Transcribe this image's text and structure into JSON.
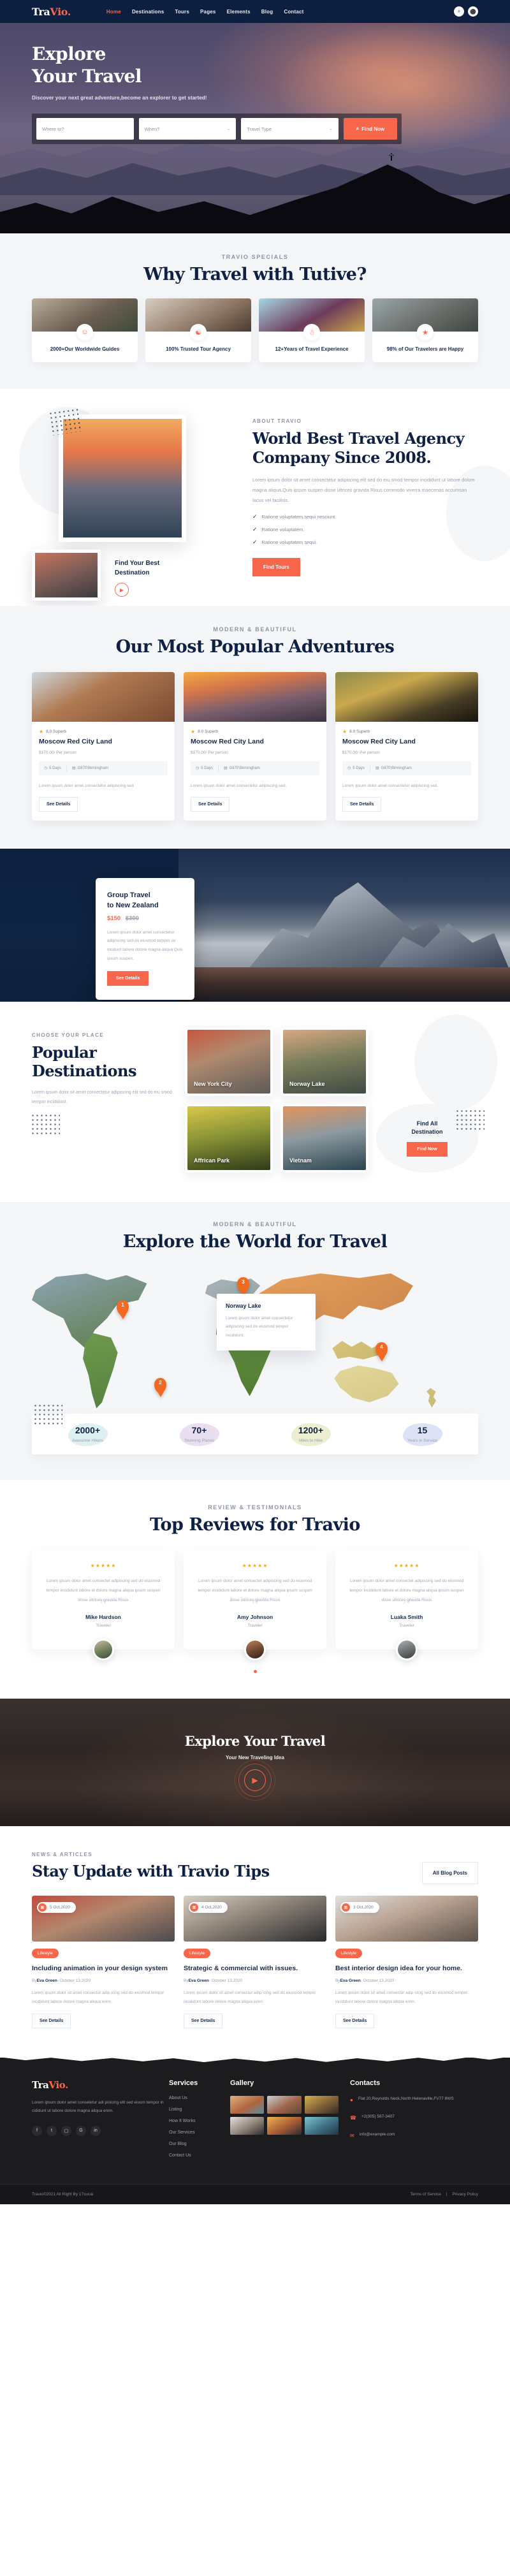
{
  "header": {
    "logo_main": "Tra",
    "logo_accent": "Vio",
    "logo_dot": ".",
    "nav": [
      {
        "label": "Home",
        "active": true
      },
      {
        "label": "Destinations",
        "active": false
      },
      {
        "label": "Tours",
        "active": false
      },
      {
        "label": "Pages",
        "active": false
      },
      {
        "label": "Elements",
        "active": false
      },
      {
        "label": "Blog",
        "active": false
      },
      {
        "label": "Contact",
        "active": false
      }
    ],
    "search_icon": "search-icon",
    "account_icon": "user-icon"
  },
  "hero": {
    "title_line1": "Explore",
    "title_line2": "Your Travel",
    "subtitle": "Discover your next great adventure,become an explorer to get started!",
    "search": {
      "where_placeholder": "Where to?",
      "when_placeholder": "When?",
      "type_placeholder": "Travel Type",
      "button_label": "Find Now"
    }
  },
  "specials": {
    "eyebrow": "TRAVIO SPECIALS",
    "title": "Why Travel with Tutive?",
    "cards": [
      {
        "icon": "guide-icon",
        "text": "2000+Our Worldwide Guides"
      },
      {
        "icon": "handshake-icon",
        "text": "100% Trusted Tour Agency"
      },
      {
        "icon": "people-icon",
        "text": "12+Years of Travel Experience"
      },
      {
        "icon": "happy-user-icon",
        "text": "98% of Our Travelers are Happy"
      }
    ]
  },
  "about": {
    "eyebrow": "ABOUT TRAVIO",
    "title": "World Best Travel Agency Company Since 2008.",
    "paragraph": "Lorem ipsum dolor sit amet consectetur adipiscing elit sed do eiu smod tempor incididunt ut labore dolore magna aliqua.Quis ipsum suspen disse ultrices gravida Risus commodo viverra maecenas accumsan lacus vel facilisis.",
    "ticks": [
      "Ratione voluptatem.sequi nesciunt.",
      "Ratione voluptatem.",
      "Ratione voluptatem sequi."
    ],
    "button_label": "Find Tours",
    "find_best_line1": "Find Your Best",
    "find_best_line2": "Destination",
    "play_icon": "play-icon"
  },
  "adventures": {
    "eyebrow": "MODERN & BEAUTIFUL",
    "title": "Our Most Popular Adventures",
    "cards": [
      {
        "rating": "8.0 Superb",
        "title": "Moscow Red City Land",
        "price": "$170.00",
        "per": "/ Per person",
        "days": "5 Days",
        "place": "G87P,Birmingham",
        "desc": "Lorem ipsum dolor amet consectetur adipiscing sed.",
        "cta": "See Details"
      },
      {
        "rating": "8.0 Superb",
        "title": "Moscow Red City Land",
        "price": "$170.00",
        "per": "/ Per person",
        "days": "5 Days",
        "place": "G87P,Birmingham",
        "desc": "Lorem ipsum dolor amet consectetur adipiscing sed.",
        "cta": "See Details"
      },
      {
        "rating": "8.0 Superb",
        "title": "Moscow Red City Land",
        "price": "$170.00",
        "per": "/ Per person",
        "days": "5 Days",
        "place": "G87P,Birmingham",
        "desc": "Lorem ipsum dolor amet consectetur adipiscing sed.",
        "cta": "See Details"
      }
    ]
  },
  "group": {
    "title_line1": "Group Travel",
    "title_line2": "to New Zealand",
    "price": "$150",
    "old_price": "$300",
    "paragraph": "Lorem ipsum dolor amet consectetur adipiscing sed do eiusmod tempor ux incidunt labore dolore magna aliqua Quis ipsum suspen.",
    "button_label": "See Details"
  },
  "destinations": {
    "eyebrow": "CHOOSE YOUR PLACE",
    "title_line1": "Popular",
    "title_line2": "Destinations",
    "paragraph": "Lorem ipsum dolor sit amet consectetur adipiscing elit sed do eiu smod tempor incididunt.",
    "cards": [
      {
        "caption": "New York City"
      },
      {
        "caption": "Norway Lake"
      },
      {
        "caption": "Affrican Park"
      },
      {
        "caption": "Vietnam"
      }
    ],
    "find_all_line1": "Find All",
    "find_all_line2": "Destination",
    "find_all_button": "Find Now"
  },
  "map": {
    "eyebrow": "MODERN & BEAUTIFUL",
    "title": "Explore the World for Travel",
    "pins": [
      "1",
      "2",
      "3",
      "4"
    ],
    "popup": {
      "title": "Norway Lake",
      "text": "Lorem ipsum dolor amet consectetur adipiscing sed do eiusmod tempor incididunt."
    }
  },
  "stats": [
    {
      "num": "2000+",
      "cap": "Awesome Hikers",
      "color": "#def0f0"
    },
    {
      "num": "70+",
      "cap": "Stunning Places",
      "color": "#e9dff0"
    },
    {
      "num": "1200+",
      "cap": "Miles to Hike",
      "color": "#eceed2"
    },
    {
      "num": "15",
      "cap": "Years in Service",
      "color": "#dde3f4"
    }
  ],
  "reviews": {
    "eyebrow": "REVIEW & TESTIMONIALS",
    "title": "Top Reviews for Travio",
    "cards": [
      {
        "stars": "★★★★★",
        "text": "Lorem ipsum dolor amet consectet adipiscing sed do eiusmod tempor incididunt labore et dolore magna aliqua ipsum suspen disse ultrices gravida Risus",
        "name": "Mike Hardson",
        "role": "Traveler"
      },
      {
        "stars": "★★★★★",
        "text": "Lorem ipsum dolor amet consectet adipiscing sed do eiusmod tempor incididunt labore et dolore magna aliqua ipsum suspen disse ultrices gravida Risus",
        "name": "Amy Johnson",
        "role": "Traveler"
      },
      {
        "stars": "★★★★★",
        "text": "Lorem ipsum dolor amet consectet adipiscing sed do eiusmod tempor incididunt labore et dolore magna aliqua ipsum suspen disse ultrices gravida Risus",
        "name": "Luaka Smith",
        "role": "Traveler"
      }
    ]
  },
  "video_cta": {
    "title": "Explore Your Travel",
    "subtitle": "Your New Traveling Idea",
    "play_icon": "play-icon"
  },
  "blog": {
    "eyebrow": "NEWS & ARTICLES",
    "title": "Stay Update with Travio Tips",
    "button_label": "All Blog Posts",
    "posts": [
      {
        "date": "5 Oct,2020",
        "tag": "Lifestyle",
        "title": "Including animation in your design system",
        "by_prefix": "By",
        "author": "Eva Green",
        "date_full": "- October 13,2020",
        "excerpt": "Lorem ipsum dolor sit amet consectur adip icing sed do eiusmod tempor incididunt labore dolore magna aliqua enim.",
        "cta": "See Details"
      },
      {
        "date": "4 Oct,2020",
        "tag": "Lifestyle",
        "title": "Strategic & commercial with issues.",
        "by_prefix": "By",
        "author": "Eva Green",
        "date_full": "- October 13,2020",
        "excerpt": "Lorem ipsum dolor sit amet consectur adip icing sed do eiusmod tempor incididunt labore dolore magna aliqua enim.",
        "cta": "See Details"
      },
      {
        "date": "3 Oct,2020",
        "tag": "Lifestyle",
        "title": "Best interior design idea for your home.",
        "by_prefix": "By",
        "author": "Eva Green",
        "date_full": "- October 13,2020",
        "excerpt": "Lorem ipsum dolor sit amet consectur adip icing sed do eiusmod tempor incididunt labore dolore magna aliqua enim.",
        "cta": "See Details"
      }
    ]
  },
  "footer": {
    "logo_main": "Tra",
    "logo_accent": "Vio",
    "logo_dot": ".",
    "about": "Lorem ipsum dolor amet consetetur adi pisicing elit sed eiusm tempor in cididunt ut labore dolore magna aliqua enim.",
    "socials": [
      "facebook-icon",
      "twitter-icon",
      "instagram-icon",
      "google-plus-icon",
      "linkedin-icon"
    ],
    "services_heading": "Services",
    "services": [
      "About Us",
      "Listing",
      "How It Works",
      "Our Services",
      "Our Blog",
      "Contact Us"
    ],
    "gallery_heading": "Gallery",
    "contacts_heading": "Contacts",
    "address": "Flat 20,Reynolds Neck,North Helenaville,FV77 8WS",
    "phone": "+2(305) 587-3407",
    "email": "info@example.com",
    "copyright": "Travio©2021 All Right By 17sucai",
    "terms": "Terms of Service",
    "privacy": "Privacy Policy"
  },
  "colors": {
    "accent": "#f8674c",
    "navy": "#0c1f3f",
    "ink": "#16284b",
    "muted": "#9aa0ae",
    "light_bg": "#f4f6f8"
  }
}
